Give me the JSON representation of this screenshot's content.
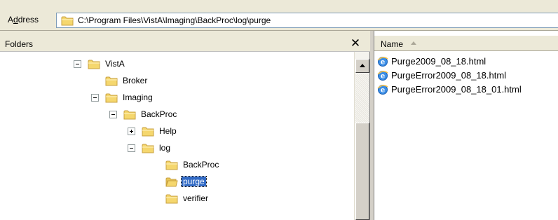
{
  "address": {
    "label_prefix": "A",
    "label_underlined": "d",
    "label_suffix": "dress",
    "path": "C:\\Program Files\\VistA\\Imaging\\BackProc\\log\\purge"
  },
  "folders": {
    "title": "Folders",
    "close": "✕",
    "tree": [
      {
        "label": "VistA",
        "expander": "minus",
        "selected": false
      },
      {
        "label": "Broker",
        "expander": "none",
        "selected": false
      },
      {
        "label": "Imaging",
        "expander": "minus",
        "selected": false
      },
      {
        "label": "BackProc",
        "expander": "minus",
        "selected": false
      },
      {
        "label": "Help",
        "expander": "plus",
        "selected": false
      },
      {
        "label": "log",
        "expander": "minus",
        "selected": false
      },
      {
        "label": "BackProc",
        "expander": "none",
        "selected": false
      },
      {
        "label": "purge",
        "expander": "none",
        "selected": true
      },
      {
        "label": "verifier",
        "expander": "none",
        "selected": false
      }
    ]
  },
  "files": {
    "column_name": "Name",
    "items": [
      {
        "name": "Purge2009_08_18.html",
        "icon": "ie-html-icon"
      },
      {
        "name": "PurgeError2009_08_18.html",
        "icon": "ie-html-icon"
      },
      {
        "name": "PurgeError2009_08_18_01.html",
        "icon": "ie-html-icon"
      }
    ]
  },
  "colors": {
    "folder_fill": "#f5d76e",
    "folder_stroke": "#c8a040",
    "selection": "#316ac5",
    "chrome": "#ece9d8"
  }
}
